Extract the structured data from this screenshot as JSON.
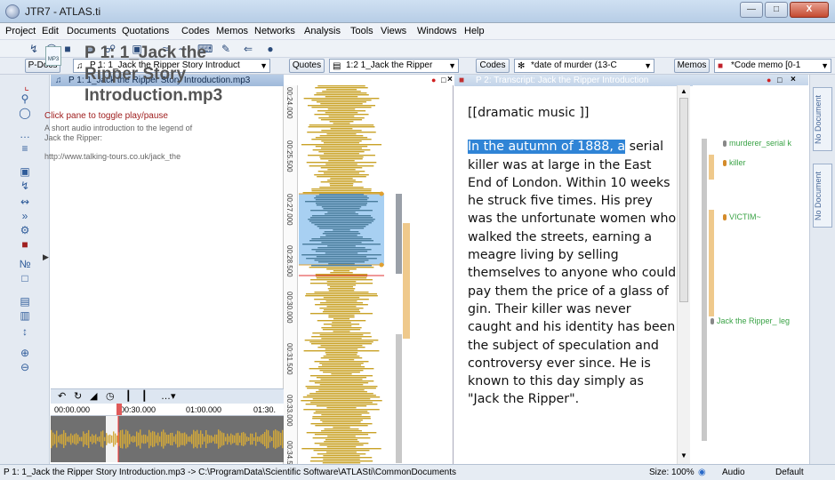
{
  "window": {
    "title": "JTR7 - ATLAS.ti"
  },
  "menu": [
    "Project",
    "Edit",
    "Documents",
    "Quotations",
    "Codes",
    "Memos",
    "Networks",
    "Analysis",
    "Tools",
    "Views",
    "Windows",
    "Help"
  ],
  "navigator": {
    "pdocs_label": "P-Docs",
    "pdocs_value": "P 1: 1_Jack the Ripper Story Introduct",
    "quotes_label": "Quotes",
    "quotes_value": "1:2 1_Jack the Ripper",
    "codes_label": "Codes",
    "codes_value": "*date of murder (13-C",
    "memos_label": "Memos",
    "memos_value": "*Code memo [0-1"
  },
  "p1": {
    "header": "P 1: 1_Jack the Ripper Story Introduction.mp3",
    "title": "P 1: 1_Jack the Ripper Story Introduction.mp3",
    "click_hint": "Click pane to toggle play/pause",
    "description": "A short audio introduction to the legend of Jack the Ripper:",
    "url": "http://www.talking-tours.co.uk/jack_the",
    "icon_label": "MP3"
  },
  "timeline": [
    "00:00.000",
    "00:30.000",
    "01:00.000",
    "01:30."
  ],
  "wave_ticks": [
    "00:24.000",
    "00:25.500",
    "00:27.000",
    "00:28.500",
    "00:30.000",
    "00:31.500",
    "00:33.000",
    "00:34.50"
  ],
  "p2": {
    "header": "P 2: Transcript: Jack the Ripper Introduction",
    "paragraph1": "[[dramatic music ]]",
    "highlight": "In the autumn of 1888, a",
    "body": "serial killer was at large in the East End of London. Within 10 weeks he struck five times. His prey was the unfortunate women who walked the streets, earning a meagre living by selling themselves to anyone who could pay them the price of a glass of gin. Their killer was never caught and his identity has been the subject of speculation and controversy ever since. He is known to this day simply as \"Jack the Ripper\"."
  },
  "codes": [
    {
      "label": "murderer_serial k",
      "color": "#888888"
    },
    {
      "label": "killer",
      "color": "#d48b2a"
    },
    {
      "label": "VICTIM~",
      "color": "#d48b2a"
    },
    {
      "label": "Jack the Ripper_ leg",
      "color": "#888888"
    }
  ],
  "side_tabs": [
    "No Document",
    "No Document"
  ],
  "status": {
    "path": "P 1: 1_Jack the Ripper Story Introduction.mp3 -> C:\\ProgramData\\Scientific Software\\ATLASti\\CommonDocuments",
    "size": "Size: 100%",
    "audio": "Audio",
    "default": "Default"
  },
  "colors": {
    "accent": "#2f84d6",
    "code_green": "#3aa346",
    "wave": "#c9a227",
    "quote_fill": "#a8d0f2"
  }
}
